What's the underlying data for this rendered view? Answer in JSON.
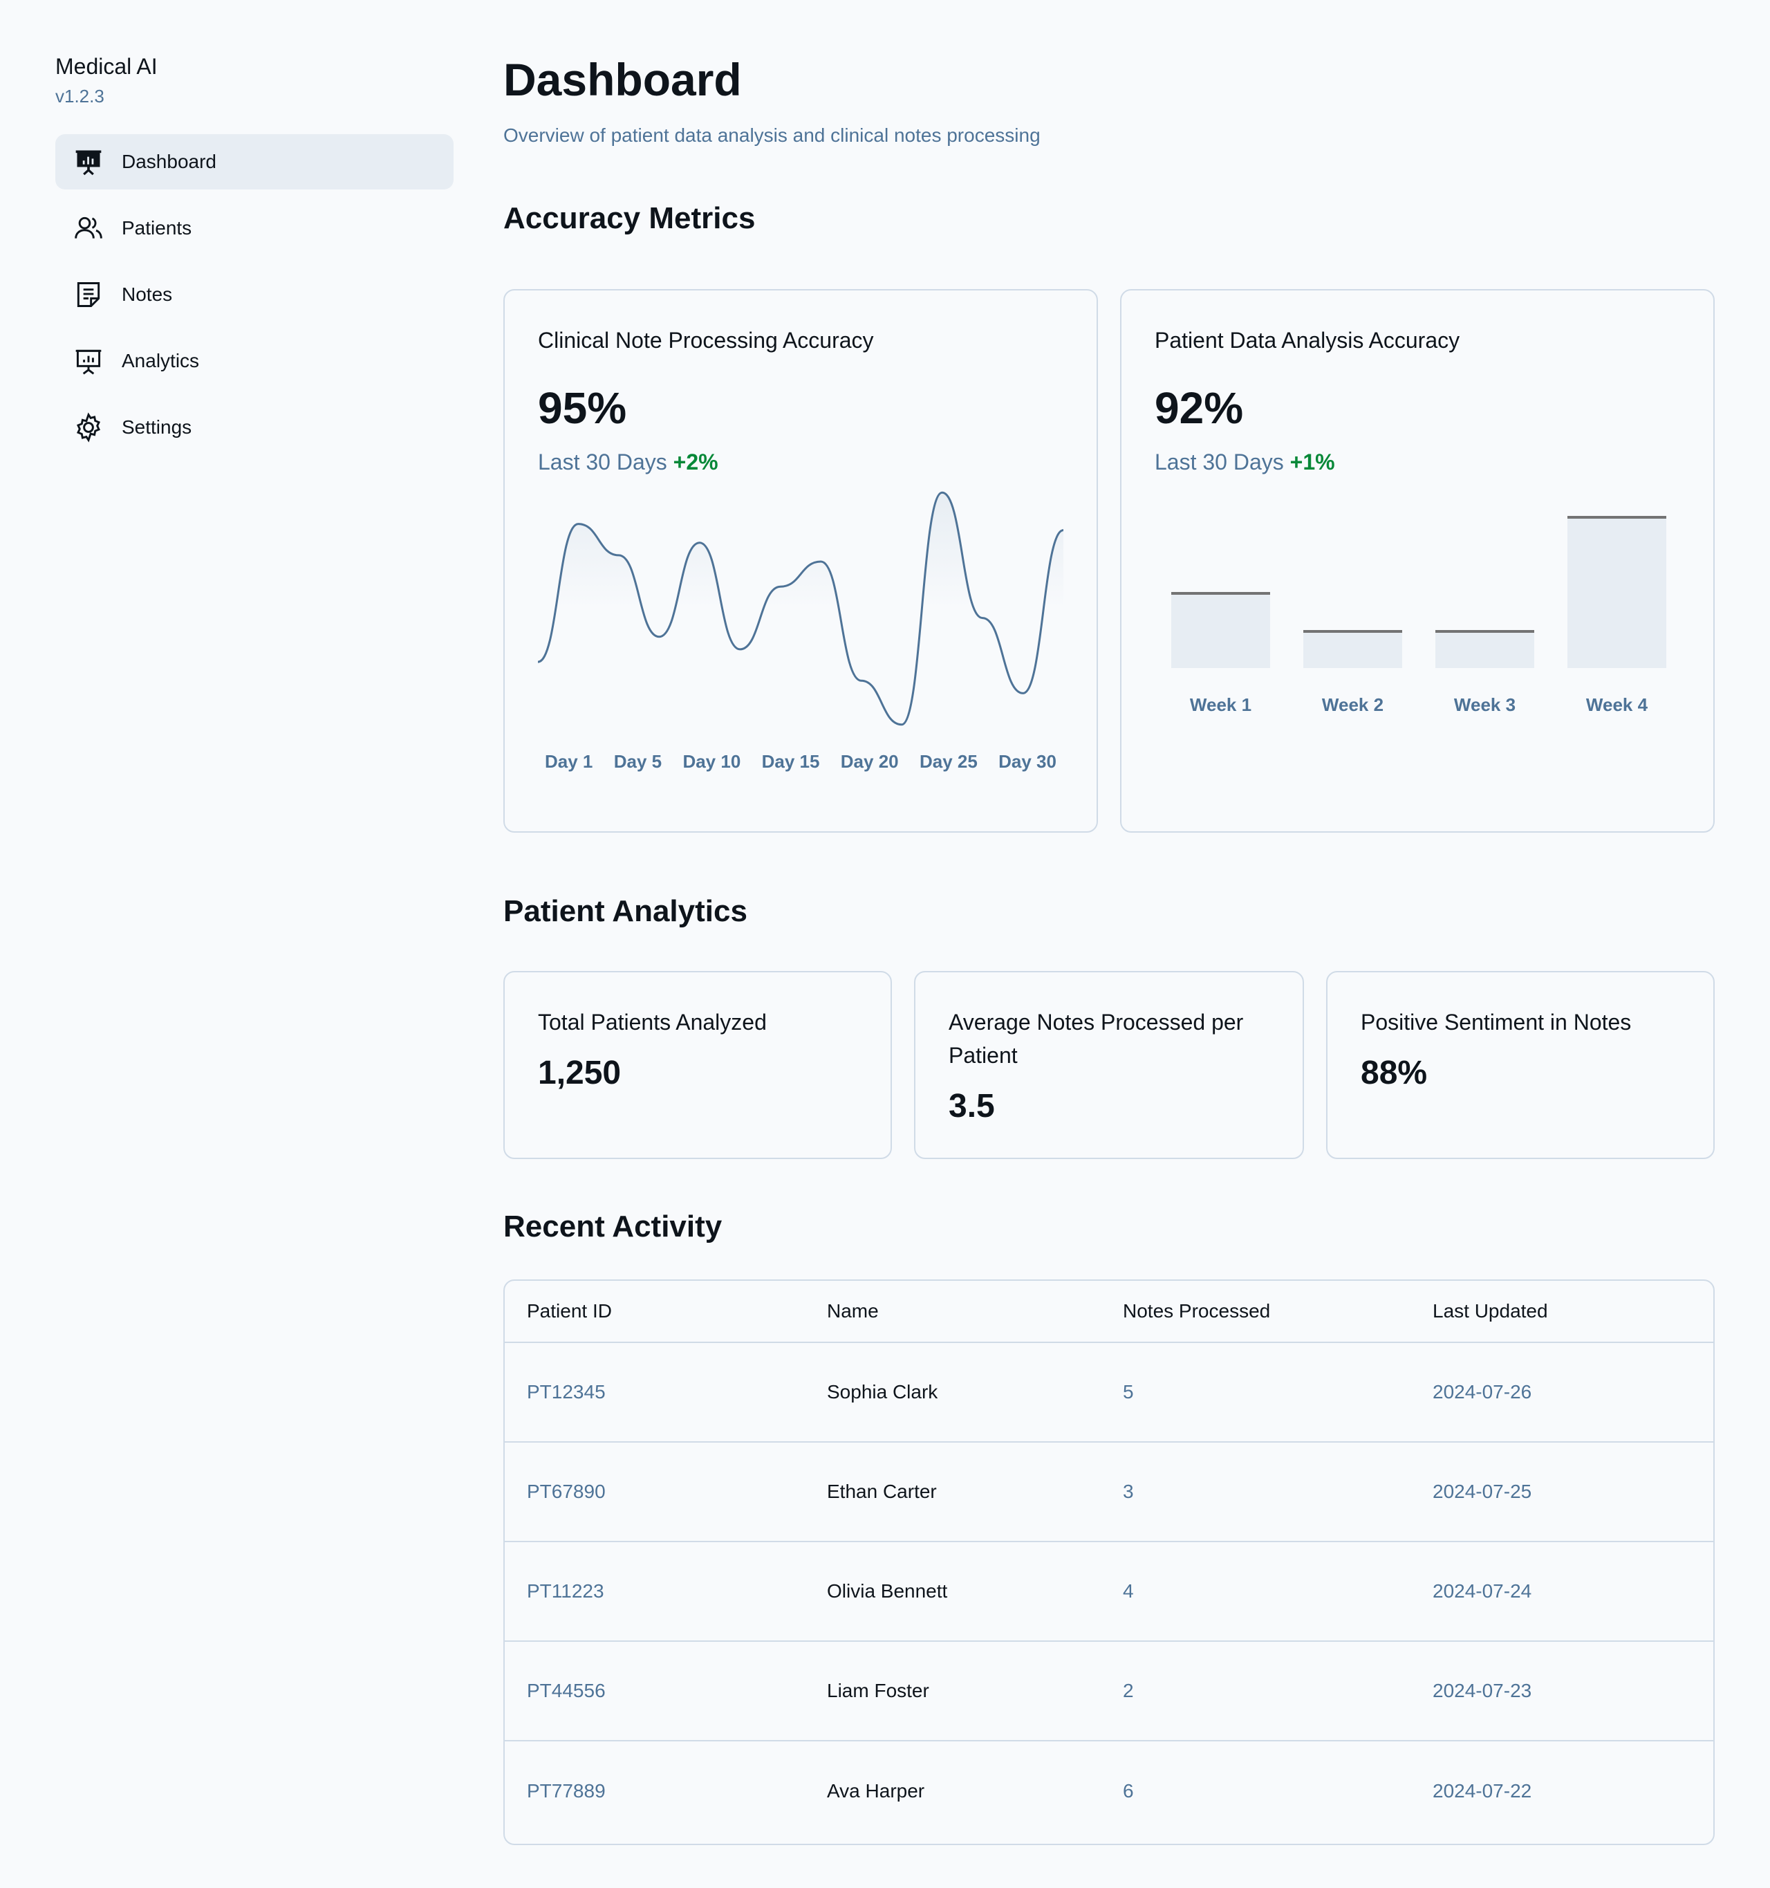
{
  "sidebar": {
    "title": "Medical AI",
    "version": "v1.2.3",
    "items": [
      {
        "label": "Dashboard",
        "icon": "presentation-chart-icon",
        "active": true
      },
      {
        "label": "Patients",
        "icon": "users-icon",
        "active": false
      },
      {
        "label": "Notes",
        "icon": "note-icon",
        "active": false
      },
      {
        "label": "Analytics",
        "icon": "presentation-chart-icon",
        "active": false
      },
      {
        "label": "Settings",
        "icon": "gear-icon",
        "active": false
      }
    ]
  },
  "header": {
    "title": "Dashboard",
    "subtitle": "Overview of patient data analysis and clinical notes processing"
  },
  "sections": {
    "accuracy": "Accuracy Metrics",
    "patient_analytics": "Patient Analytics",
    "recent_activity": "Recent Activity"
  },
  "accuracy_cards": [
    {
      "title": "Clinical Note Processing Accuracy",
      "value": "95%",
      "period": "Last 30 Days",
      "change": "+2%"
    },
    {
      "title": "Patient Data Analysis Accuracy",
      "value": "92%",
      "period": "Last 30 Days",
      "change": "+1%"
    }
  ],
  "colors": {
    "accent": "#4e7397",
    "positive": "#078838",
    "bar_fill": "#e7edf3",
    "border": "#d0dbe7"
  },
  "chart_data": [
    {
      "type": "line",
      "x_tick_labels": [
        "Day 1",
        "Day 5",
        "Day 10",
        "Day 15",
        "Day 20",
        "Day 25",
        "Day 30"
      ],
      "grid": false,
      "legend": "none"
    },
    {
      "type": "bar",
      "categories": [
        "Week 1",
        "Week 2",
        "Week 3",
        "Week 4"
      ],
      "values": [
        0.5,
        0.25,
        0.25,
        1.0
      ],
      "grid": false,
      "legend": "none"
    }
  ],
  "stats": [
    {
      "title": "Total Patients Analyzed",
      "value": "1,250"
    },
    {
      "title": "Average Notes Processed per Patient",
      "value": "3.5"
    },
    {
      "title": "Positive Sentiment in Notes",
      "value": "88%"
    }
  ],
  "table": {
    "headers": [
      "Patient ID",
      "Name",
      "Notes Processed",
      "Last Updated"
    ],
    "rows": [
      [
        "PT12345",
        "Sophia Clark",
        "5",
        "2024-07-26"
      ],
      [
        "PT67890",
        "Ethan Carter",
        "3",
        "2024-07-25"
      ],
      [
        "PT11223",
        "Olivia Bennett",
        "4",
        "2024-07-24"
      ],
      [
        "PT44556",
        "Liam Foster",
        "2",
        "2024-07-23"
      ],
      [
        "PT77889",
        "Ava Harper",
        "6",
        "2024-07-22"
      ]
    ]
  }
}
